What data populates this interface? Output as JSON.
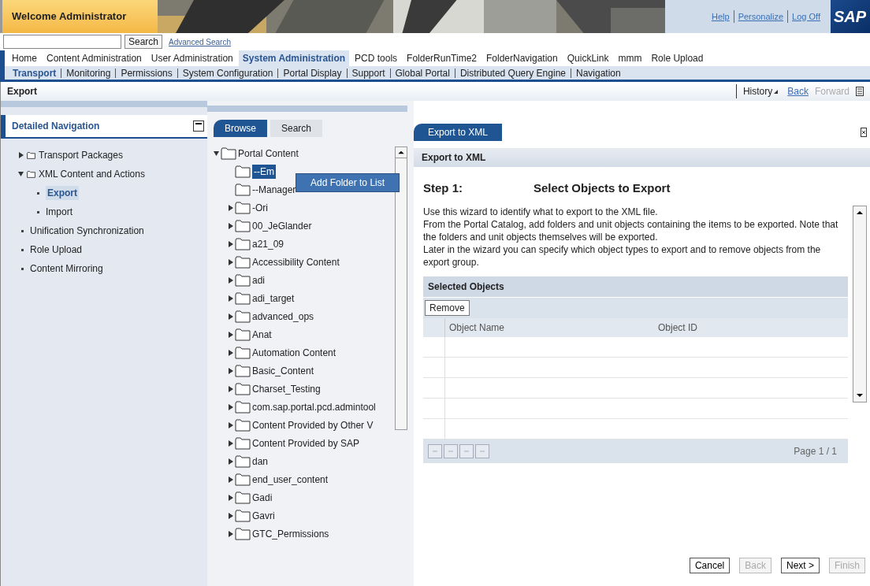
{
  "header": {
    "welcome": "Welcome Administrator",
    "links": [
      "Help",
      "Personalize",
      "Log Off"
    ],
    "logo": "SAP"
  },
  "search": {
    "button": "Search",
    "advanced_link": "Advanced Search"
  },
  "top_nav": [
    {
      "label": "Home",
      "selected": false
    },
    {
      "label": "Content Administration",
      "selected": false
    },
    {
      "label": "User Administration",
      "selected": false
    },
    {
      "label": "System Administration",
      "selected": true
    },
    {
      "label": "PCD tools",
      "selected": false
    },
    {
      "label": "FolderRunTime2",
      "selected": false
    },
    {
      "label": "FolderNavigation",
      "selected": false
    },
    {
      "label": "QuickLink",
      "selected": false
    },
    {
      "label": "mmm",
      "selected": false
    },
    {
      "label": "Role Upload",
      "selected": false
    }
  ],
  "sub_nav": [
    {
      "label": "Transport",
      "selected": true
    },
    {
      "label": "Monitoring",
      "selected": false
    },
    {
      "label": "Permissions",
      "selected": false
    },
    {
      "label": "System Configuration",
      "selected": false
    },
    {
      "label": "Portal Display",
      "selected": false
    },
    {
      "label": "Support",
      "selected": false
    },
    {
      "label": "Global Portal",
      "selected": false
    },
    {
      "label": "Distributed Query Engine",
      "selected": false
    },
    {
      "label": "Navigation",
      "selected": false
    }
  ],
  "page": {
    "title": "Export",
    "history": "History",
    "back": "Back",
    "forward": "Forward",
    "forward_disabled": true
  },
  "detailed_navigation": {
    "title": "Detailed Navigation",
    "items": [
      {
        "label": "Transport Packages",
        "kind": "folder",
        "expanded": false,
        "selected": false
      },
      {
        "label": "XML Content and Actions",
        "kind": "folder",
        "expanded": true,
        "selected": false,
        "children": [
          {
            "label": "Export",
            "kind": "page",
            "selected": true
          },
          {
            "label": "Import",
            "kind": "page",
            "selected": false
          }
        ]
      },
      {
        "label": "Unification Synchronization",
        "kind": "page",
        "selected": false
      },
      {
        "label": "Role Upload",
        "kind": "page",
        "selected": false
      },
      {
        "label": "Content Mirroring",
        "kind": "page",
        "selected": false
      }
    ]
  },
  "catalog": {
    "tabs": [
      {
        "label": "Browse",
        "selected": true
      },
      {
        "label": "Search",
        "selected": false
      }
    ],
    "root": {
      "label": "Portal Content",
      "expanded": true,
      "children": [
        {
          "label": "--Em",
          "expandable": false,
          "selected": true
        },
        {
          "label": "--Manager",
          "expandable": false,
          "selected": false
        },
        {
          "label": "-Ori",
          "expandable": true,
          "selected": false
        },
        {
          "label": "00_JeGlander",
          "expandable": true,
          "selected": false
        },
        {
          "label": "a21_09",
          "expandable": true,
          "selected": false
        },
        {
          "label": "Accessibility Content",
          "expandable": true,
          "selected": false
        },
        {
          "label": "adi",
          "expandable": true,
          "selected": false
        },
        {
          "label": "adi_target",
          "expandable": true,
          "selected": false
        },
        {
          "label": "advanced_ops",
          "expandable": true,
          "selected": false
        },
        {
          "label": "Anat",
          "expandable": true,
          "selected": false
        },
        {
          "label": "Automation Content",
          "expandable": true,
          "selected": false
        },
        {
          "label": "Basic_Content",
          "expandable": true,
          "selected": false
        },
        {
          "label": "Charset_Testing",
          "expandable": true,
          "selected": false
        },
        {
          "label": "com.sap.portal.pcd.admintool",
          "expandable": true,
          "selected": false
        },
        {
          "label": "Content Provided by Other V",
          "expandable": true,
          "selected": false
        },
        {
          "label": "Content Provided by SAP",
          "expandable": true,
          "selected": false
        },
        {
          "label": "dan",
          "expandable": true,
          "selected": false
        },
        {
          "label": "end_user_content",
          "expandable": true,
          "selected": false
        },
        {
          "label": "Gadi",
          "expandable": true,
          "selected": false
        },
        {
          "label": "Gavri",
          "expandable": true,
          "selected": false
        },
        {
          "label": "GTC_Permissions",
          "expandable": true,
          "selected": false
        }
      ]
    },
    "context_menu": [
      "Add Folder to List"
    ]
  },
  "wizard": {
    "tab": "Export to XML",
    "title": "Export to XML",
    "step": "Step 1:",
    "step_title": "Select Objects to Export",
    "paragraphs": [
      "Use this wizard to identify what to export to the XML file.",
      "From the Portal Catalog, add folders and unit objects containing the items to be exported. Note that the folders and unit objects themselves will be exported.",
      "Later in the wizard you can specify which object types to export and to remove objects from the export group."
    ],
    "table": {
      "title": "Selected Objects",
      "remove_button": "Remove",
      "columns": [
        "Object Name",
        "Object ID"
      ],
      "pager": "Page 1 / 1"
    },
    "buttons": [
      {
        "label": "Cancel",
        "disabled": false
      },
      {
        "label": "Back",
        "disabled": true
      },
      {
        "label": "Next >",
        "disabled": false
      },
      {
        "label": "Finish",
        "disabled": true
      }
    ]
  }
}
